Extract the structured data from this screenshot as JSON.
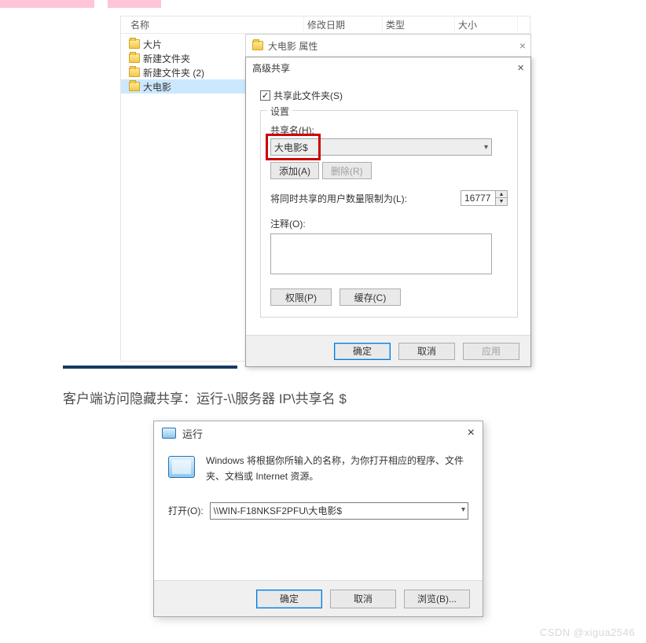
{
  "explorer": {
    "columns": {
      "name": "名称",
      "date": "修改日期",
      "type": "类型",
      "size": "大小"
    },
    "items": [
      {
        "label": "大片"
      },
      {
        "label": "新建文件夹"
      },
      {
        "label": "新建文件夹 (2)"
      },
      {
        "label": "大电影"
      }
    ]
  },
  "props": {
    "title": "大电影 属性"
  },
  "adv": {
    "title": "高级共享",
    "share_checkbox": "共享此文件夹(S)",
    "settings_legend": "设置",
    "share_name_label": "共享名(H):",
    "share_name_value": "大电影$",
    "add_btn": "添加(A)",
    "remove_btn": "删除(R)",
    "limit_label": "将同时共享的用户数量限制为(L):",
    "limit_value": "16777",
    "comment_label": "注释(O):",
    "perm_btn": "权限(P)",
    "cache_btn": "缓存(C)",
    "ok": "确定",
    "cancel": "取消",
    "apply": "应用"
  },
  "instruction": "客户端访问隐藏共享：运行-\\\\服务器 IP\\共享名 $",
  "run": {
    "title": "运行",
    "desc": "Windows 将根据你所输入的名称，为你打开相应的程序、文件夹、文档或 Internet 资源。",
    "open_label": "打开(O):",
    "open_value": "\\\\WIN-F18NKSF2PFU\\大电影$",
    "ok": "确定",
    "cancel": "取消",
    "browse": "浏览(B)..."
  },
  "watermark": "CSDN @xigua2546"
}
